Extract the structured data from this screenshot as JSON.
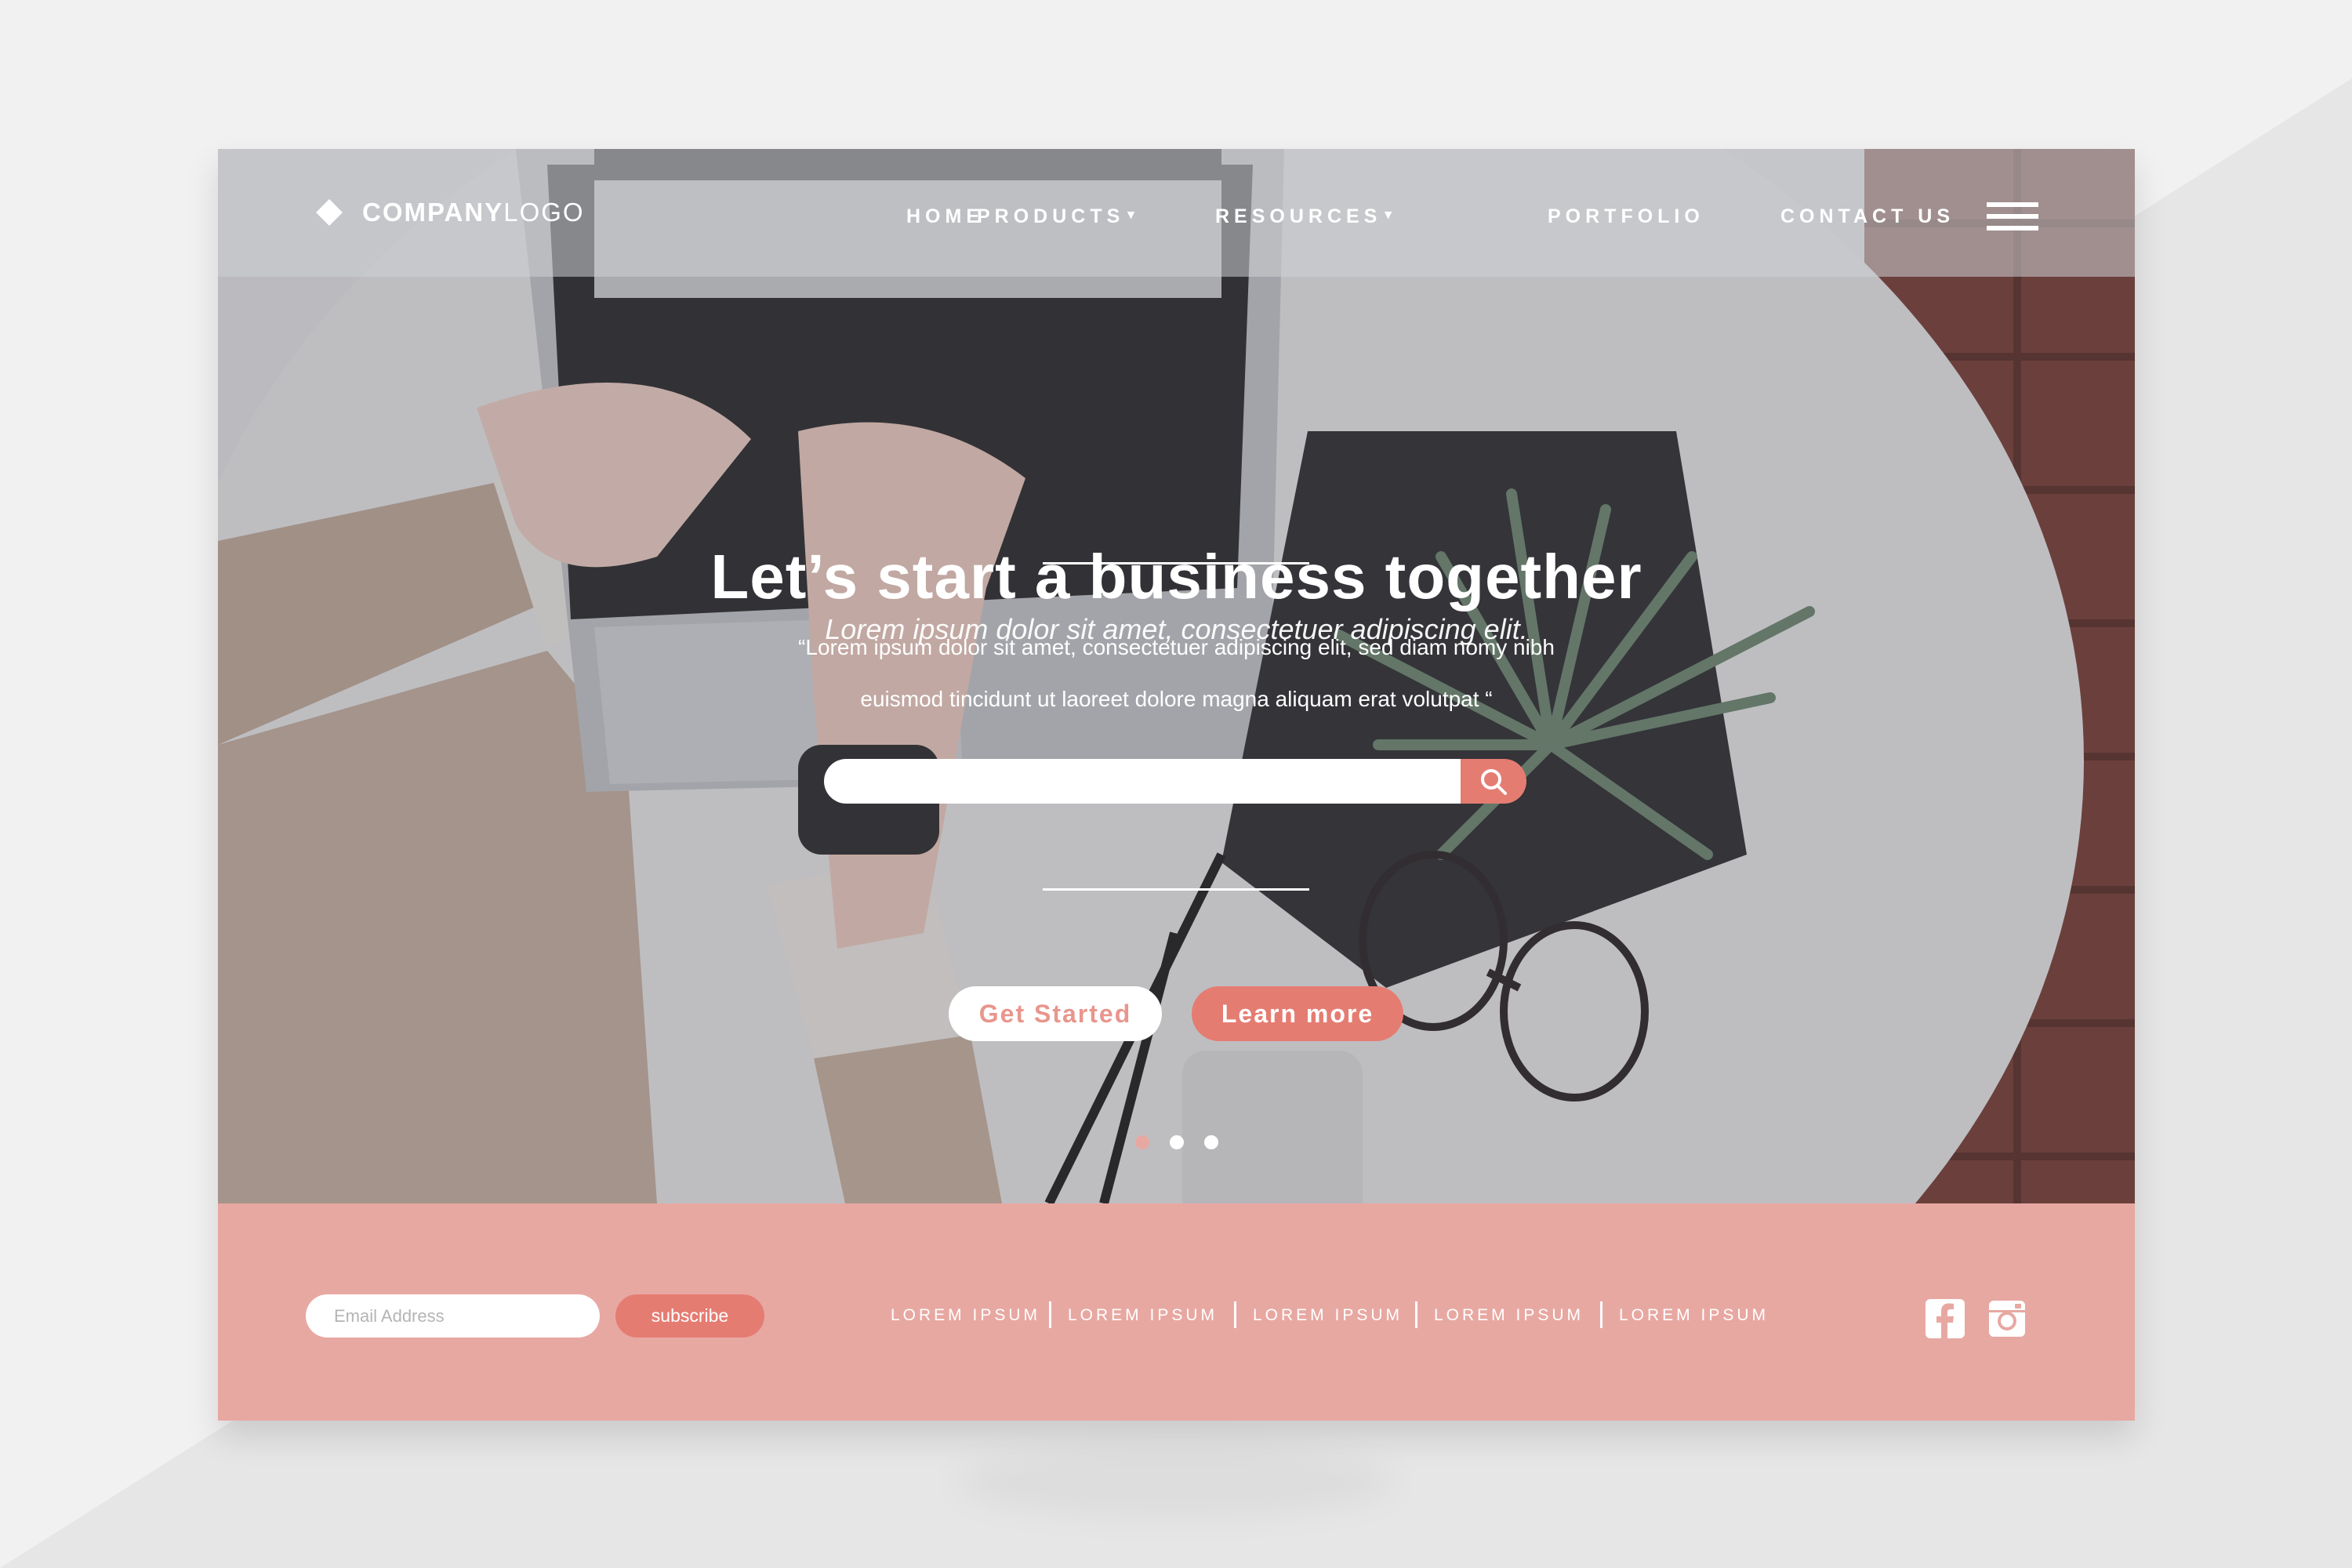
{
  "colors": {
    "accent": "#e57c72",
    "footer_bg": "#e8a8a2",
    "button_text_light": "#e8968d",
    "white": "#ffffff"
  },
  "header": {
    "logo_bold": "COMPANY",
    "logo_light": "LOGO",
    "logo_icon": "diamond-icon",
    "nav": [
      {
        "label": "HOME",
        "has_caret": false
      },
      {
        "label": "PRODUCTS",
        "has_caret": true
      },
      {
        "label": "RESOURCES",
        "has_caret": true
      },
      {
        "label": "PORTFOLIO",
        "has_caret": false
      },
      {
        "label": "CONTACT US",
        "has_caret": false
      }
    ],
    "caret_glyph": "▾",
    "menu_icon": "hamburger-icon"
  },
  "hero": {
    "title": "Let’s  start a business together",
    "subtitle": "Lorem ipsum dolor sit amet, consectetuer adipiscing elit.",
    "quote_line1": "“Lorem ipsum dolor sit amet, consectetuer adipiscing elit, sed diam nomy nibh",
    "quote_line2": "euismod tincidunt ut laoreet dolore magna aliquam erat volutpat “",
    "search": {
      "value": "",
      "placeholder": "",
      "icon": "search-icon"
    },
    "buttons": {
      "get_started": "Get Started",
      "learn_more": "Learn more"
    },
    "carousel": {
      "count": 3,
      "active_index": 0
    }
  },
  "footer": {
    "email_placeholder": "Email Address",
    "subscribe_label": "subscribe",
    "links": [
      "LOREM IPSUM",
      "LOREM IPSUM",
      "LOREM IPSUM",
      "LOREM IPSUM",
      "LOREM IPSUM"
    ],
    "social_icons": [
      "facebook-icon",
      "instagram-icon"
    ]
  }
}
